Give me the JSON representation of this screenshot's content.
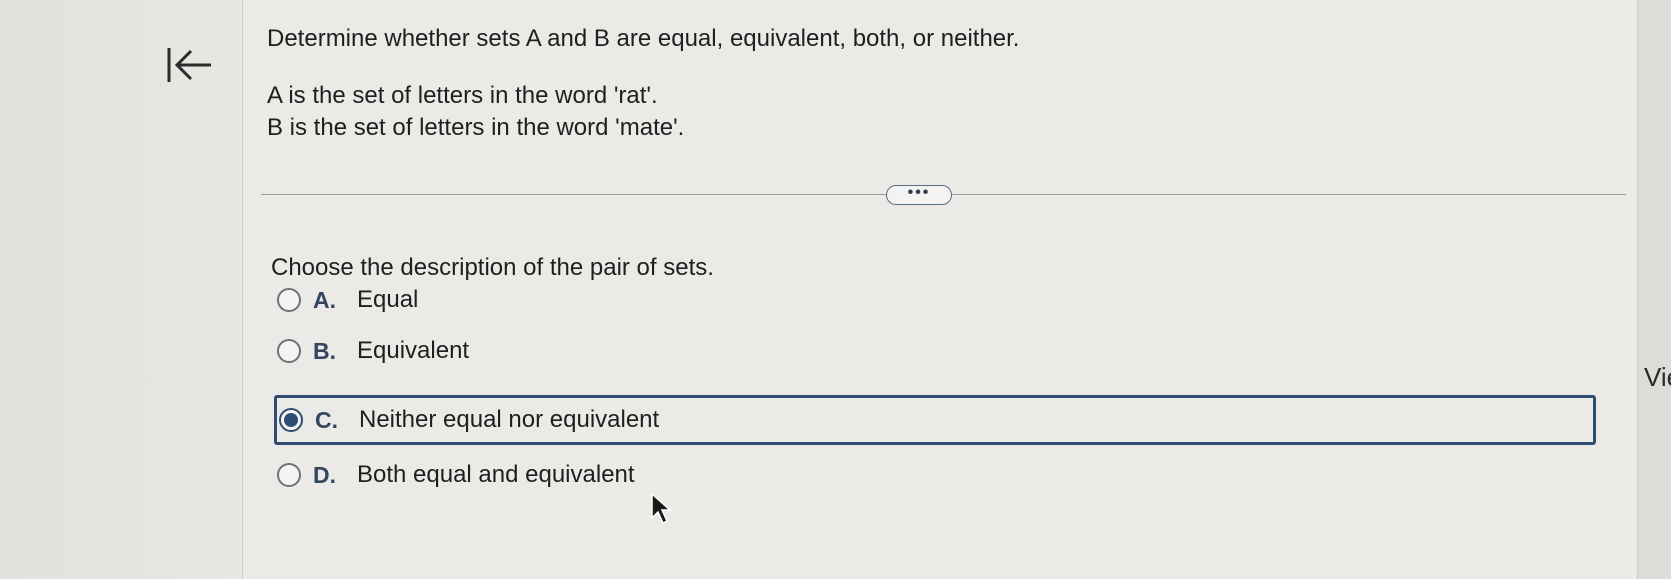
{
  "question": {
    "prompt": "Determine whether sets A and B are equal, equivalent, both, or neither.",
    "set_a": "A is the set of letters in the word 'rat'.",
    "set_b": "B is the set of letters in the word 'mate'."
  },
  "more_button": {
    "label": "•••"
  },
  "answer_prompt": "Choose the description of the pair of sets.",
  "choices": [
    {
      "letter": "A.",
      "text": "Equal",
      "selected": false
    },
    {
      "letter": "B.",
      "text": "Equivalent",
      "selected": false
    },
    {
      "letter": "C.",
      "text": "Neither equal nor equivalent",
      "selected": true
    },
    {
      "letter": "D.",
      "text": "Both equal and equivalent",
      "selected": false
    }
  ],
  "right_panel": {
    "peek_text": "Vie"
  },
  "colors": {
    "accent": "#304c73",
    "letter": "#33455f",
    "background": "#ebeae7"
  }
}
